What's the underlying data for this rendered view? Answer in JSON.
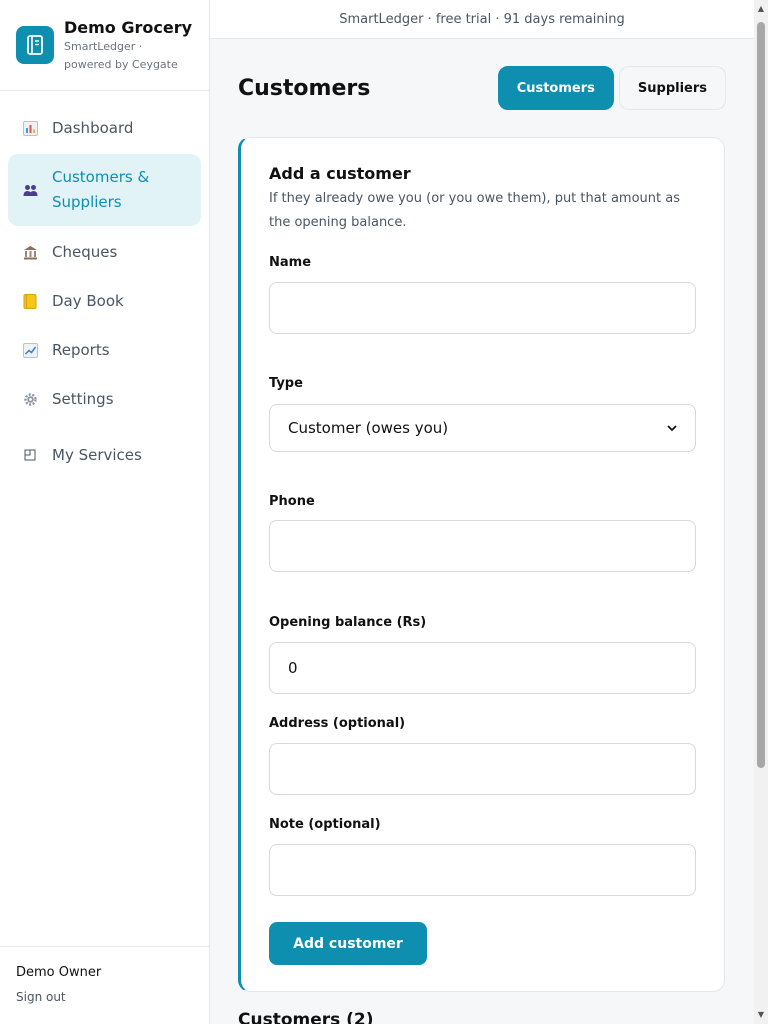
{
  "brand": {
    "name": "Demo Grocery",
    "subtitle": "SmartLedger · powered by Ceygate"
  },
  "nav": [
    {
      "label": "Dashboard",
      "icon": "bar-chart-icon"
    },
    {
      "label": "Customers & Suppliers",
      "icon": "people-icon",
      "active": true
    },
    {
      "label": "Cheques",
      "icon": "bank-icon"
    },
    {
      "label": "Day Book",
      "icon": "notebook-icon"
    },
    {
      "label": "Reports",
      "icon": "line-chart-icon"
    },
    {
      "label": "Settings",
      "icon": "gear-icon"
    },
    {
      "label": "My Services",
      "icon": "window-icon"
    }
  ],
  "user": {
    "name": "Demo Owner",
    "signout": "Sign out"
  },
  "banner": "SmartLedger · free trial · 91 days remaining",
  "page": {
    "title": "Customers",
    "tabs": [
      "Customers",
      "Suppliers"
    ]
  },
  "form": {
    "title": "Add a customer",
    "description": "If they already owe you (or you owe them), put that amount as the opening balance.",
    "name_label": "Name",
    "name_value": "",
    "type_label": "Type",
    "type_value": "Customer (owes you)",
    "phone_label": "Phone",
    "phone_value": "",
    "balance_label": "Opening balance (Rs)",
    "balance_value": "0",
    "address_label": "Address (optional)",
    "address_value": "",
    "note_label": "Note (optional)",
    "note_value": "",
    "submit_label": "Add customer"
  },
  "list": {
    "title": "Customers (2)"
  },
  "colors": {
    "accent": "#0e8fb0",
    "active_bg": "#e1f3f7"
  }
}
